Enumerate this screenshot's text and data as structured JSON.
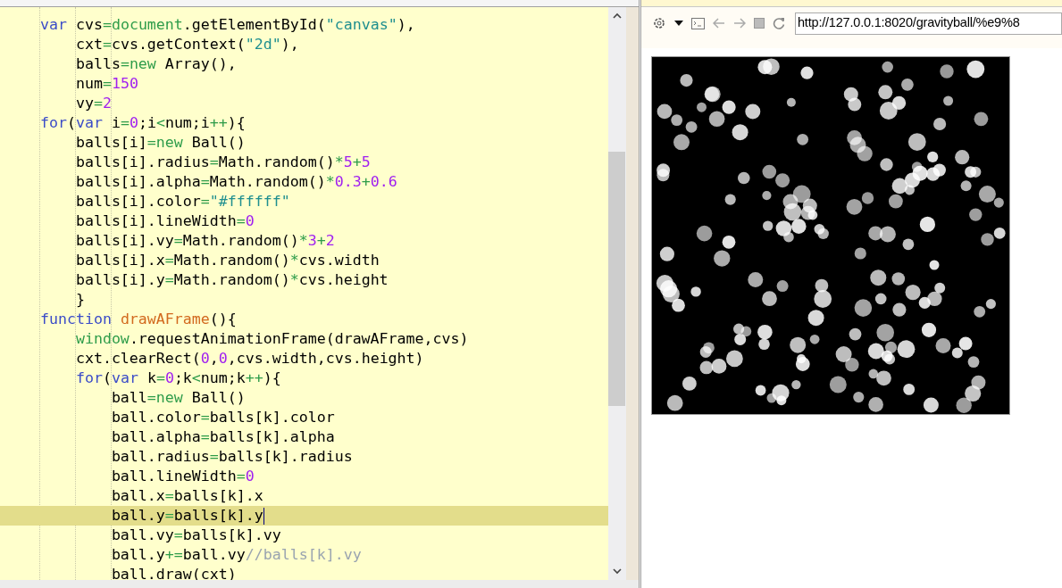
{
  "editor": {
    "lines": [
      {
        "current": false,
        "tokens": [
          {
            "kind": "keyword",
            "text": "    var"
          },
          {
            "kind": "plain",
            "text": " cvs"
          },
          {
            "kind": "operator",
            "text": "="
          },
          {
            "kind": "builtin",
            "text": "document"
          },
          {
            "kind": "plain",
            "text": ".getElementById("
          },
          {
            "kind": "string",
            "text": "\"canvas\""
          },
          {
            "kind": "plain",
            "text": "),"
          }
        ]
      },
      {
        "current": false,
        "tokens": [
          {
            "kind": "plain",
            "text": "        cxt"
          },
          {
            "kind": "operator",
            "text": "="
          },
          {
            "kind": "plain",
            "text": "cvs.getContext("
          },
          {
            "kind": "string",
            "text": "\"2d\""
          },
          {
            "kind": "plain",
            "text": "),"
          }
        ]
      },
      {
        "current": false,
        "tokens": [
          {
            "kind": "plain",
            "text": "        balls"
          },
          {
            "kind": "operator",
            "text": "="
          },
          {
            "kind": "builtin",
            "text": "new"
          },
          {
            "kind": "plain",
            "text": " Array(),"
          }
        ]
      },
      {
        "current": false,
        "tokens": [
          {
            "kind": "plain",
            "text": "        num"
          },
          {
            "kind": "operator",
            "text": "="
          },
          {
            "kind": "number",
            "text": "150"
          }
        ]
      },
      {
        "current": false,
        "tokens": [
          {
            "kind": "plain",
            "text": "        vy"
          },
          {
            "kind": "operator",
            "text": "="
          },
          {
            "kind": "number",
            "text": "2"
          }
        ]
      },
      {
        "current": false,
        "tokens": [
          {
            "kind": "keyword",
            "text": "    for"
          },
          {
            "kind": "plain",
            "text": "("
          },
          {
            "kind": "keyword",
            "text": "var"
          },
          {
            "kind": "plain",
            "text": " i"
          },
          {
            "kind": "operator",
            "text": "="
          },
          {
            "kind": "number",
            "text": "0"
          },
          {
            "kind": "plain",
            "text": ";i"
          },
          {
            "kind": "operator",
            "text": "<"
          },
          {
            "kind": "plain",
            "text": "num;i"
          },
          {
            "kind": "operator",
            "text": "++"
          },
          {
            "kind": "plain",
            "text": "){"
          }
        ]
      },
      {
        "current": false,
        "tokens": [
          {
            "kind": "plain",
            "text": "        balls[i]"
          },
          {
            "kind": "operator",
            "text": "="
          },
          {
            "kind": "builtin",
            "text": "new"
          },
          {
            "kind": "plain",
            "text": " Ball()"
          }
        ]
      },
      {
        "current": false,
        "tokens": [
          {
            "kind": "plain",
            "text": "        balls[i].radius"
          },
          {
            "kind": "operator",
            "text": "="
          },
          {
            "kind": "plain",
            "text": "Math.random()"
          },
          {
            "kind": "operator",
            "text": "*"
          },
          {
            "kind": "number",
            "text": "5"
          },
          {
            "kind": "operator",
            "text": "+"
          },
          {
            "kind": "number",
            "text": "5"
          }
        ]
      },
      {
        "current": false,
        "tokens": [
          {
            "kind": "plain",
            "text": "        balls[i].alpha"
          },
          {
            "kind": "operator",
            "text": "="
          },
          {
            "kind": "plain",
            "text": "Math.random()"
          },
          {
            "kind": "operator",
            "text": "*"
          },
          {
            "kind": "number",
            "text": "0.3"
          },
          {
            "kind": "operator",
            "text": "+"
          },
          {
            "kind": "number",
            "text": "0.6"
          }
        ]
      },
      {
        "current": false,
        "tokens": [
          {
            "kind": "plain",
            "text": "        balls[i].color"
          },
          {
            "kind": "operator",
            "text": "="
          },
          {
            "kind": "string",
            "text": "\"#ffffff\""
          }
        ]
      },
      {
        "current": false,
        "tokens": [
          {
            "kind": "plain",
            "text": "        balls[i].lineWidth"
          },
          {
            "kind": "operator",
            "text": "="
          },
          {
            "kind": "number",
            "text": "0"
          }
        ]
      },
      {
        "current": false,
        "tokens": [
          {
            "kind": "plain",
            "text": "        balls[i].vy"
          },
          {
            "kind": "operator",
            "text": "="
          },
          {
            "kind": "plain",
            "text": "Math.random()"
          },
          {
            "kind": "operator",
            "text": "*"
          },
          {
            "kind": "number",
            "text": "3"
          },
          {
            "kind": "operator",
            "text": "+"
          },
          {
            "kind": "number",
            "text": "2"
          }
        ]
      },
      {
        "current": false,
        "tokens": [
          {
            "kind": "plain",
            "text": "        balls[i].x"
          },
          {
            "kind": "operator",
            "text": "="
          },
          {
            "kind": "plain",
            "text": "Math.random()"
          },
          {
            "kind": "operator",
            "text": "*"
          },
          {
            "kind": "plain",
            "text": "cvs.width"
          }
        ]
      },
      {
        "current": false,
        "tokens": [
          {
            "kind": "plain",
            "text": "        balls[i].y"
          },
          {
            "kind": "operator",
            "text": "="
          },
          {
            "kind": "plain",
            "text": "Math.random()"
          },
          {
            "kind": "operator",
            "text": "*"
          },
          {
            "kind": "plain",
            "text": "cvs.height"
          }
        ]
      },
      {
        "current": false,
        "tokens": [
          {
            "kind": "plain",
            "text": "        }"
          }
        ]
      },
      {
        "current": false,
        "tokens": [
          {
            "kind": "keyword",
            "text": "    function"
          },
          {
            "kind": "function",
            "text": " drawAFrame"
          },
          {
            "kind": "plain",
            "text": "(){"
          }
        ]
      },
      {
        "current": false,
        "tokens": [
          {
            "kind": "builtin",
            "text": "        window"
          },
          {
            "kind": "plain",
            "text": ".requestAnimationFrame(drawAFrame,cvs)"
          }
        ]
      },
      {
        "current": false,
        "tokens": [
          {
            "kind": "plain",
            "text": "        cxt.clearRect("
          },
          {
            "kind": "number",
            "text": "0"
          },
          {
            "kind": "plain",
            "text": ","
          },
          {
            "kind": "number",
            "text": "0"
          },
          {
            "kind": "plain",
            "text": ",cvs.width,cvs.height)"
          }
        ]
      },
      {
        "current": false,
        "tokens": [
          {
            "kind": "keyword",
            "text": "        for"
          },
          {
            "kind": "plain",
            "text": "("
          },
          {
            "kind": "keyword",
            "text": "var"
          },
          {
            "kind": "plain",
            "text": " k"
          },
          {
            "kind": "operator",
            "text": "="
          },
          {
            "kind": "number",
            "text": "0"
          },
          {
            "kind": "plain",
            "text": ";k"
          },
          {
            "kind": "operator",
            "text": "<"
          },
          {
            "kind": "plain",
            "text": "num;k"
          },
          {
            "kind": "operator",
            "text": "++"
          },
          {
            "kind": "plain",
            "text": "){"
          }
        ]
      },
      {
        "current": false,
        "tokens": [
          {
            "kind": "plain",
            "text": "            ball"
          },
          {
            "kind": "operator",
            "text": "="
          },
          {
            "kind": "builtin",
            "text": "new"
          },
          {
            "kind": "plain",
            "text": " Ball()"
          }
        ]
      },
      {
        "current": false,
        "tokens": [
          {
            "kind": "plain",
            "text": "            ball.color"
          },
          {
            "kind": "operator",
            "text": "="
          },
          {
            "kind": "plain",
            "text": "balls[k].color"
          }
        ]
      },
      {
        "current": false,
        "tokens": [
          {
            "kind": "plain",
            "text": "            ball.alpha"
          },
          {
            "kind": "operator",
            "text": "="
          },
          {
            "kind": "plain",
            "text": "balls[k].alpha"
          }
        ]
      },
      {
        "current": false,
        "tokens": [
          {
            "kind": "plain",
            "text": "            ball.radius"
          },
          {
            "kind": "operator",
            "text": "="
          },
          {
            "kind": "plain",
            "text": "balls[k].radius"
          }
        ]
      },
      {
        "current": false,
        "tokens": [
          {
            "kind": "plain",
            "text": "            ball.lineWidth"
          },
          {
            "kind": "operator",
            "text": "="
          },
          {
            "kind": "number",
            "text": "0"
          }
        ]
      },
      {
        "current": false,
        "tokens": [
          {
            "kind": "plain",
            "text": "            ball.x"
          },
          {
            "kind": "operator",
            "text": "="
          },
          {
            "kind": "plain",
            "text": "balls[k].x"
          }
        ]
      },
      {
        "current": true,
        "tokens": [
          {
            "kind": "plain",
            "text": "            ball.y"
          },
          {
            "kind": "operator",
            "text": "="
          },
          {
            "kind": "plain",
            "text": "balls[k].y"
          }
        ]
      },
      {
        "current": false,
        "tokens": [
          {
            "kind": "plain",
            "text": "            ball.vy"
          },
          {
            "kind": "operator",
            "text": "="
          },
          {
            "kind": "plain",
            "text": "balls[k].vy"
          }
        ]
      },
      {
        "current": false,
        "tokens": [
          {
            "kind": "plain",
            "text": "            ball.y"
          },
          {
            "kind": "operator",
            "text": "+="
          },
          {
            "kind": "plain",
            "text": "ball.vy"
          },
          {
            "kind": "comment",
            "text": "//balls[k].vy"
          }
        ]
      },
      {
        "current": false,
        "tokens": [
          {
            "kind": "plain",
            "text": "            ball.draw(cxt)"
          }
        ]
      }
    ]
  },
  "browser": {
    "url": "http://127.0.0.1:8020/gravityball/%e9%8"
  }
}
